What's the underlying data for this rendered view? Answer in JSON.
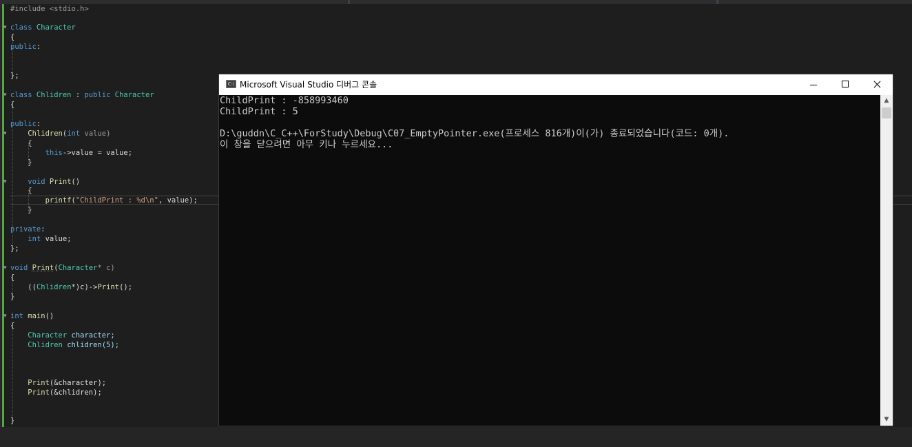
{
  "editor": {
    "lines": {
      "l1": {
        "a": "#include <stdio.h>"
      },
      "l2": {
        "a": "class",
        "b": " Character"
      },
      "l3": {
        "a": "{"
      },
      "l4": {
        "a": "public",
        "b": ":"
      },
      "l5": {
        "a": "};"
      },
      "l6": {
        "a": "class",
        "b": " Chlidren",
        "c": " : ",
        "d": "public",
        "e": " Character"
      },
      "l7": {
        "a": "{"
      },
      "l8": {
        "a": "public",
        "b": ":"
      },
      "l9": {
        "a": "    ",
        "b": "Chlidren",
        "c": "(",
        "d": "int",
        "e": " value)"
      },
      "l10": {
        "a": "    {"
      },
      "l11": {
        "a": "        ",
        "b": "this",
        "c": "->value = value;"
      },
      "l12": {
        "a": "    }"
      },
      "l13": {
        "a": "    ",
        "b": "void",
        "c": " ",
        "d": "Print",
        "e": "()"
      },
      "l14": {
        "a": "    {"
      },
      "l15": {
        "a": "        ",
        "b": "printf",
        "c": "(",
        "d": "\"ChildPrint : %d\\n\"",
        "e": ", value);"
      },
      "l16": {
        "a": "    }"
      },
      "l17": {
        "a": "private",
        "b": ":"
      },
      "l18": {
        "a": "    ",
        "b": "int",
        "c": " value;"
      },
      "l19": {
        "a": "};"
      },
      "l20": {
        "a": "void",
        "b": " ",
        "c": "Print",
        "d": "(",
        "e": "Character",
        "f": "* c)"
      },
      "l21": {
        "a": "{"
      },
      "l22": {
        "a": "    ((",
        "b": "Chlidren",
        "c": "*)c)->",
        "d": "Print",
        "e": "();"
      },
      "l23": {
        "a": "}"
      },
      "l24": {
        "a": "int",
        "b": " ",
        "c": "main",
        "d": "()"
      },
      "l25": {
        "a": "{"
      },
      "l26": {
        "a": "    ",
        "b": "Character",
        "c": " character;"
      },
      "l27": {
        "a": "    ",
        "b": "Chlidren",
        "c": " chlidren(5);"
      },
      "l28": {
        "a": "    ",
        "b": "Print",
        "c": "(&character);"
      },
      "l29": {
        "a": "    ",
        "b": "Print",
        "c": "(&chlidren);"
      },
      "l30": {
        "a": "}"
      }
    }
  },
  "console": {
    "icon_label": "C:\\",
    "title": "Microsoft Visual Studio 디버그 콘솔",
    "lines": [
      "ChildPrint : -858993460",
      "ChildPrint : 5",
      "",
      "D:\\guddn\\C_C++\\ForStudy\\Debug\\C07_EmptyPointer.exe(프로세스 816개)이(가) 종료되었습니다(코드: 0개).",
      "이 창을 닫으려면 아무 키나 누르세요..."
    ]
  },
  "icons": {
    "fold": "▾",
    "scroll_up": "▲",
    "scroll_down": "▼"
  }
}
